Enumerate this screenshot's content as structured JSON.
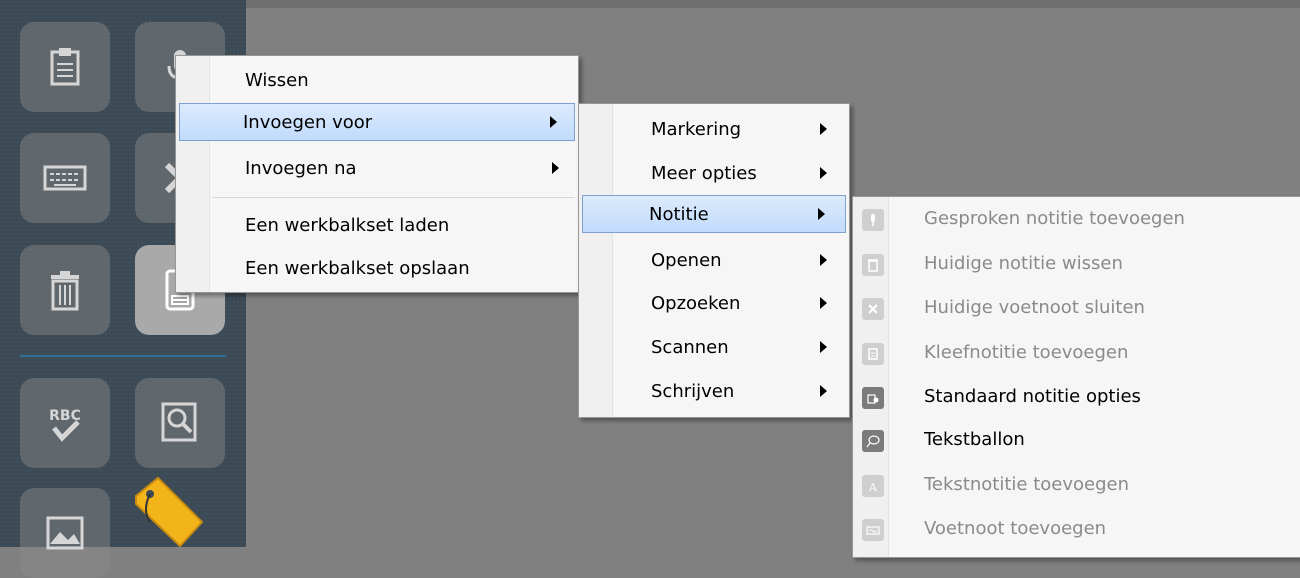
{
  "toolbar": {
    "buttons": [
      {
        "icon": "clipboard-paste-icon"
      },
      {
        "icon": "microphone-icon"
      },
      {
        "icon": "keyboard-icon"
      },
      {
        "icon": "close-icon"
      },
      {
        "icon": "trash-icon"
      },
      {
        "icon": "sticky-note-icon"
      },
      {
        "icon": "spellcheck-icon",
        "text": "RBC"
      },
      {
        "icon": "magnifier-document-icon"
      },
      {
        "icon": "image-icon"
      },
      {
        "icon": "tag-icon"
      }
    ]
  },
  "context_menu": {
    "items": [
      {
        "label": "Wissen"
      },
      {
        "label": "Invoegen voor"
      },
      {
        "label": "Invoegen na"
      },
      {
        "label": "Een werkbalkset laden"
      },
      {
        "label": "Een werkbalkset opslaan"
      }
    ]
  },
  "submenu": {
    "items": [
      {
        "label": "Markering"
      },
      {
        "label": "Meer opties"
      },
      {
        "label": "Notitie"
      },
      {
        "label": "Openen"
      },
      {
        "label": "Opzoeken"
      },
      {
        "label": "Scannen"
      },
      {
        "label": "Schrijven"
      }
    ]
  },
  "notitie_menu": {
    "items": [
      {
        "label": "Gesproken notitie toevoegen",
        "icon": "microphone-icon",
        "enabled": false
      },
      {
        "label": "Huidige notitie wissen",
        "icon": "trash-icon",
        "enabled": false
      },
      {
        "label": "Huidige voetnoot sluiten",
        "icon": "close-icon",
        "enabled": false
      },
      {
        "label": "Kleefnotitie toevoegen",
        "icon": "sticky-note-icon",
        "enabled": false
      },
      {
        "label": "Standaard notitie opties",
        "icon": "note-options-icon",
        "enabled": true
      },
      {
        "label": "Tekstballon",
        "icon": "speech-bubble-icon",
        "enabled": true
      },
      {
        "label": "Tekstnotitie toevoegen",
        "icon": "text-note-icon",
        "enabled": false
      },
      {
        "label": "Voetnoot toevoegen",
        "icon": "footnote-icon",
        "enabled": false
      }
    ]
  },
  "colors": {
    "toolbar_bg": "#3b4a55",
    "workspace_bg": "#808080",
    "highlight": "#c1dbfc",
    "separator": "#2f6f96"
  }
}
